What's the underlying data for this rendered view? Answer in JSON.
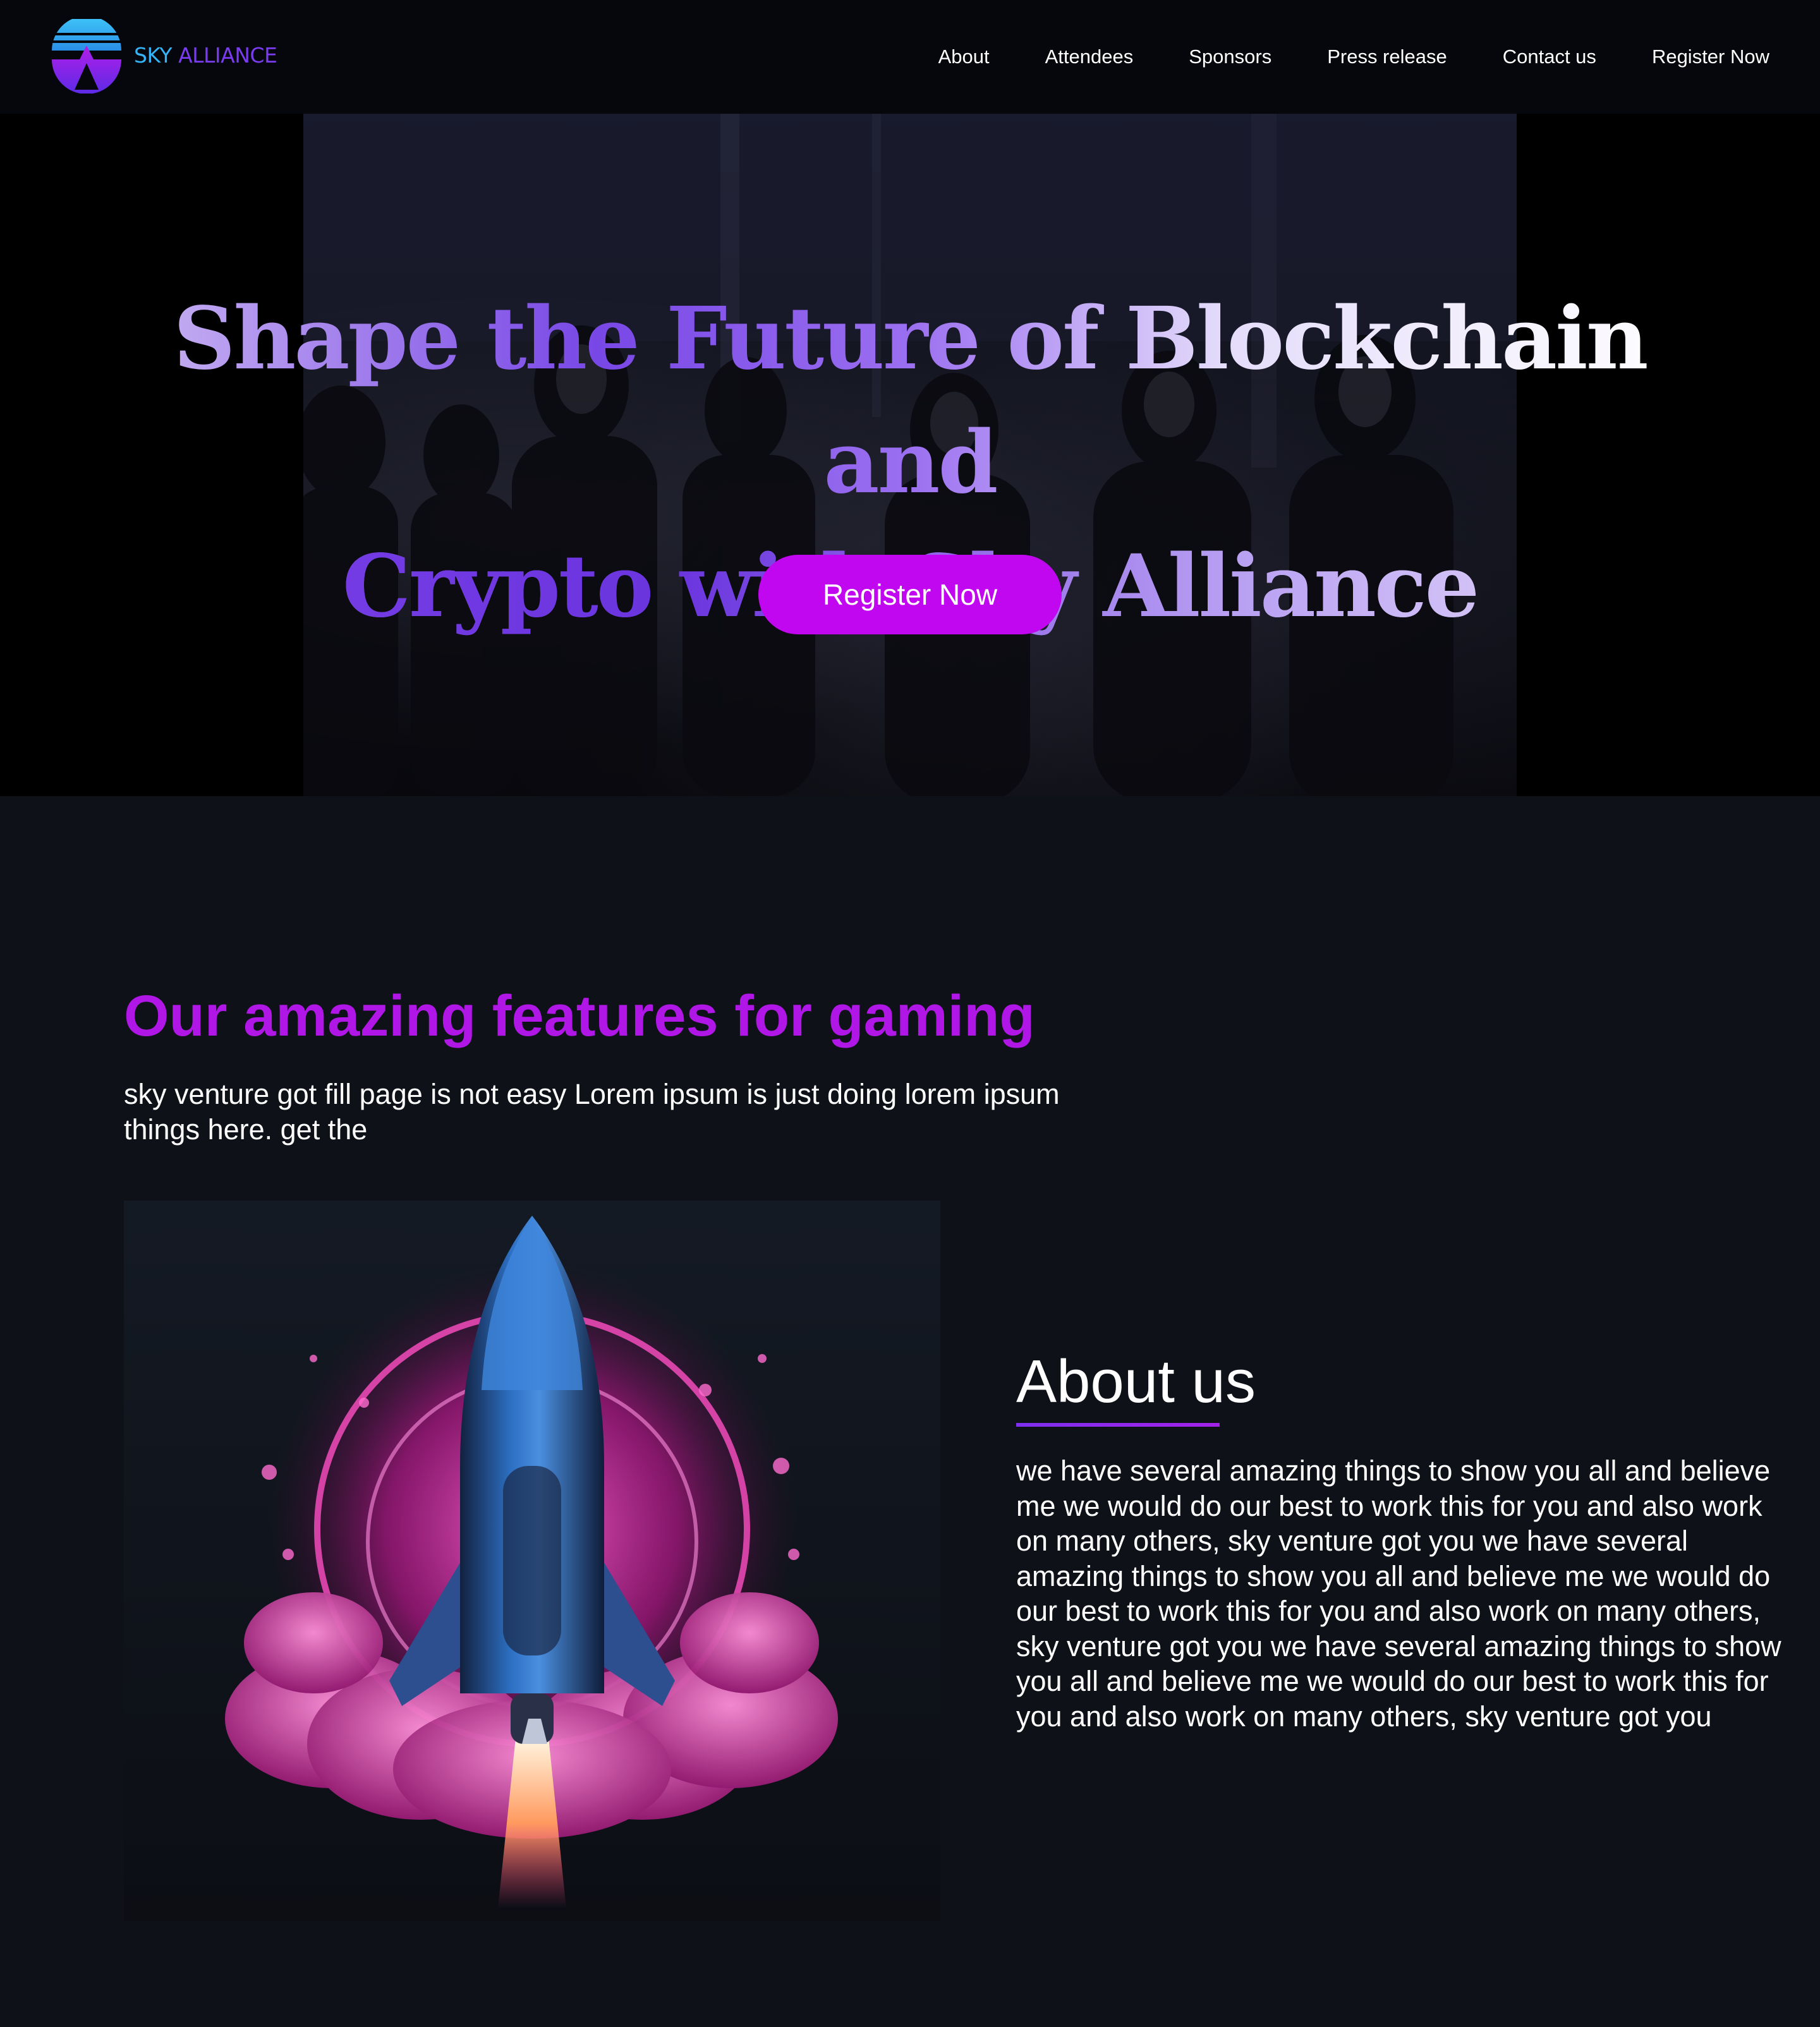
{
  "brand": {
    "name_part1": "SKY",
    "name_part2": "ALLIANCE",
    "colors": {
      "blue": "#34b4f6",
      "purple": "#7a3bf1"
    }
  },
  "nav": {
    "items": [
      {
        "label": "About"
      },
      {
        "label": "Attendees"
      },
      {
        "label": "Sponsors"
      },
      {
        "label": "Press release"
      },
      {
        "label": "Contact us"
      },
      {
        "label": "Register Now"
      }
    ]
  },
  "hero": {
    "title_line1": "Shape the Future of Blockchain and",
    "title_line2": "Crypto with Sky Alliance",
    "cta_label": "Register Now",
    "cta_color": "#c107ef"
  },
  "features": {
    "title": "Our amazing features for gaming",
    "title_color": "#b017e6",
    "description": "sky venture got fill page is not easy Lorem ipsum is just doing lorem ipsum things here. get the"
  },
  "about": {
    "title": "About us",
    "body": "we have several amazing things to show you all and believe me we would do our best to work this for you and also work on many others, sky venture got you we have several amazing things to show you all and believe me we would do our best to work this for you and also work on many others, sky venture got you we have several amazing things to show you all and believe me we would do our best to work this for you and also work on many others, sky venture got you"
  },
  "images": {
    "hero_background": "crowd-photo",
    "feature_image": "rocket-launch-illustration"
  }
}
